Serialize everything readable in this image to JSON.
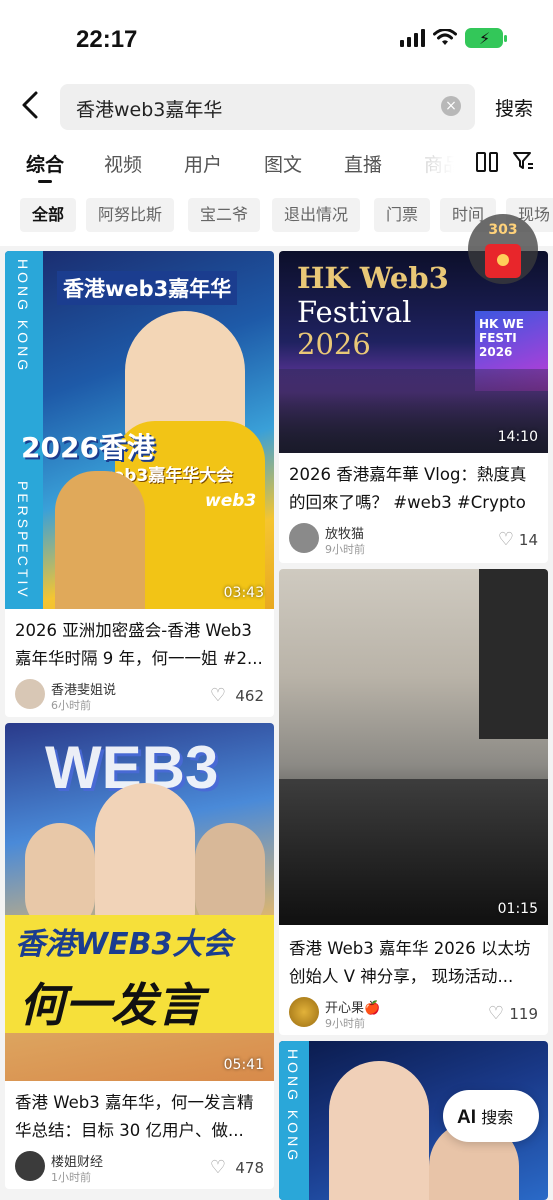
{
  "status": {
    "time": "22:17"
  },
  "search": {
    "query": "香港web3嘉年华",
    "button": "搜索"
  },
  "tabs": [
    "综合",
    "视频",
    "用户",
    "图文",
    "直播",
    "商品"
  ],
  "chips": [
    "全部",
    "阿努比斯",
    "宝二爷",
    "退出情况",
    "门票",
    "时间",
    "现场"
  ],
  "red_packet": {
    "count": "303"
  },
  "ai_button": {
    "label": "AI",
    "text": "搜索"
  },
  "cards": [
    {
      "thumb_title": "香港web3嘉年华",
      "thumb_big": "2026香港",
      "thumb_sub": "web3嘉年华大会",
      "thumb_tag": "web3",
      "thumb_vertical_left": "HONG KONG",
      "thumb_vertical_right": "PERSPECTIV",
      "duration": "03:43",
      "title": "2026 亚洲加密盛会-香港 Web3 嘉年华时隔 9 年，何一一姐 #2...",
      "author": "香港斐姐说",
      "time": "6小时前",
      "likes": "462"
    },
    {
      "thumb_line1": "HK Web3",
      "thumb_line2": "Festival",
      "thumb_line3": "2026",
      "thumb_screen": "HK WE FESTI 2026",
      "duration": "14:10",
      "title": "2026 香港嘉年華 Vlog：熱度真的回來了嗎？ #web3 #Crypto",
      "author": "放牧猫",
      "time": "9小时前",
      "likes": "14"
    },
    {
      "duration": "01:15",
      "title": "香港 Web3 嘉年华 2026 以太坊创始人 V 神分享， 现场活动...",
      "author": "开心果🍎",
      "time": "9小时前",
      "likes": "119"
    },
    {
      "thumb_logo": "WEB3",
      "thumb_big": "香港WEB3大会",
      "thumb_big2": "何一发言",
      "duration": "05:41",
      "title": "香港 Web3 嘉年华，何一发言精华总结：目标 30 亿用户、做...",
      "author": "楼姐财经",
      "time": "1小时前",
      "likes": "478"
    },
    {
      "thumb_vertical": "HONG KONG"
    }
  ]
}
